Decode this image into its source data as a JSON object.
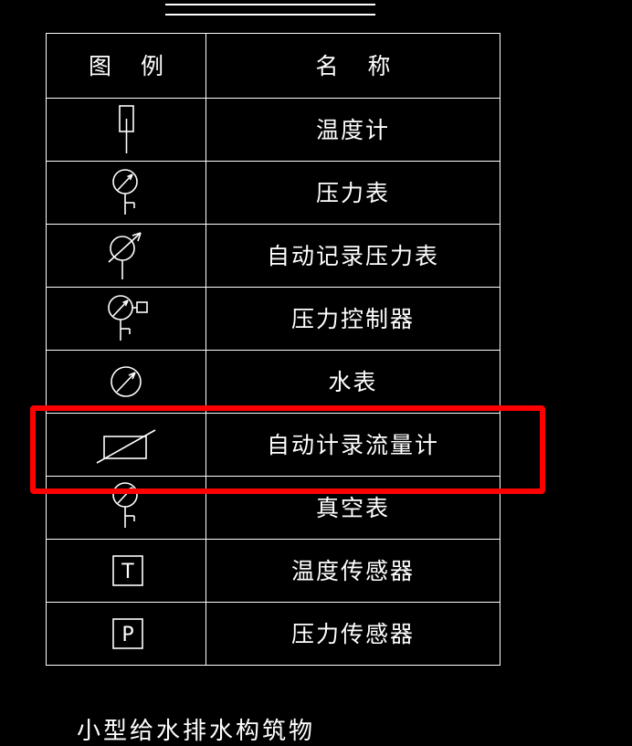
{
  "page": {
    "background_color": "#000000",
    "stroke_color": "#ffffff",
    "highlight_color": "#ff0000"
  },
  "title_rule": {
    "name": "double-underline-rule",
    "lines": 2
  },
  "table": {
    "headers": {
      "symbol": "图 例",
      "name": "名 称"
    },
    "rows": [
      {
        "symbol_icon": "thermometer-icon",
        "name": "温度计"
      },
      {
        "symbol_icon": "pressure-gauge-icon",
        "name": "压力表"
      },
      {
        "symbol_icon": "recording-pressure-gauge-icon",
        "name": "自动记录压力表"
      },
      {
        "symbol_icon": "pressure-controller-icon",
        "name": "压力控制器"
      },
      {
        "symbol_icon": "water-meter-icon",
        "name": "水表"
      },
      {
        "symbol_icon": "recording-flow-meter-icon",
        "name": "自动计录流量计"
      },
      {
        "symbol_icon": "vacuum-gauge-icon",
        "name": "真空表"
      },
      {
        "symbol_icon": "temperature-sensor-icon",
        "name": "温度传感器",
        "symbol_letter": "T"
      },
      {
        "symbol_icon": "pressure-sensor-icon",
        "name": "压力传感器",
        "symbol_letter": "P"
      }
    ]
  },
  "highlight": {
    "name": "red-selection-box",
    "target_row_index": 5,
    "target_row_name": "自动计录流量计",
    "color": "#ff0000"
  },
  "caption": {
    "text": "小型给水排水构筑物"
  }
}
